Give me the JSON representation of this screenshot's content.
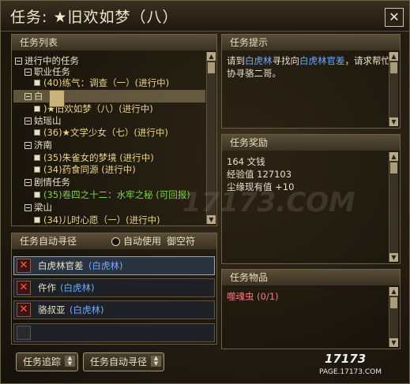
{
  "window": {
    "title": "任务: ★旧欢如梦（八）",
    "close": "✕"
  },
  "task_list": {
    "header": "任务列表",
    "tree": [
      {
        "label": "进行中的任务",
        "color": "#e8e0c8",
        "kind": "group"
      },
      {
        "label": "职业任务",
        "color": "#e8e0c8",
        "kind": "group"
      },
      {
        "label": "(40)练气：调查（一）(进行中)",
        "color": "#e8d48a",
        "kind": "item"
      },
      {
        "label": "白",
        "color": "#e8e0c8",
        "kind": "group"
      },
      {
        "label": ")★旧欢如梦（八）(进行中)",
        "color": "#e8d48a",
        "kind": "item"
      },
      {
        "label": "姑瑶山",
        "color": "#e8e0c8",
        "kind": "group"
      },
      {
        "label": "(36)★文学少女（七）(进行中)",
        "color": "#e8d48a",
        "kind": "item"
      },
      {
        "label": "济南",
        "color": "#e8e0c8",
        "kind": "group"
      },
      {
        "label": "(35)朱雀女的梦境 (进行中)",
        "color": "#e8d48a",
        "kind": "item"
      },
      {
        "label": "(34)药食同源 (进行中)",
        "color": "#e8d48a",
        "kind": "item"
      },
      {
        "label": "剧情任务",
        "color": "#e8e0c8",
        "kind": "group"
      },
      {
        "label": "(35)卷四之十二：水牢之秘 (可回报)",
        "color": "#7fd24a",
        "kind": "item"
      },
      {
        "label": "梁山",
        "color": "#e8e0c8",
        "kind": "group"
      },
      {
        "label": "(34)儿时心愿（一）(进行中)",
        "color": "#e8d48a",
        "kind": "item"
      }
    ]
  },
  "auto_path": {
    "header": "任务自动寻径",
    "checkbox_label": "自动使用",
    "fly_label": "御空符",
    "rows": [
      {
        "name": "白虎林官差",
        "place": "(白虎林)"
      },
      {
        "name": "仵作",
        "place": "(白虎林)"
      },
      {
        "name": "骆叔亚",
        "place": "(白虎林)"
      }
    ],
    "icon": "✕"
  },
  "hint": {
    "header": "任务提示",
    "pre": "请到",
    "link1": "白虎林",
    "mid": "寻找向",
    "link2": "白虎林官差",
    "post": "，请求帮忙",
    "line2": "协寻骆二哥。"
  },
  "reward": {
    "header": "任务奖励",
    "lines": [
      "164 文钱",
      "经验值 127103",
      "尘缘现有值 +10"
    ]
  },
  "items": {
    "header": "任务物品",
    "lines": [
      "噬魂虫 (0/1)"
    ]
  },
  "buttons": {
    "track": "任务追踪",
    "auto": "任务自动寻径"
  },
  "watermark": {
    "main": "17173.COM",
    "logo": "17173",
    "site": "PAGE.17173.COM"
  },
  "colors": {
    "link": "#6ea8ff",
    "item_red": "#ff7a7a",
    "green": "#7fd24a",
    "gold": "#e8d48a"
  }
}
